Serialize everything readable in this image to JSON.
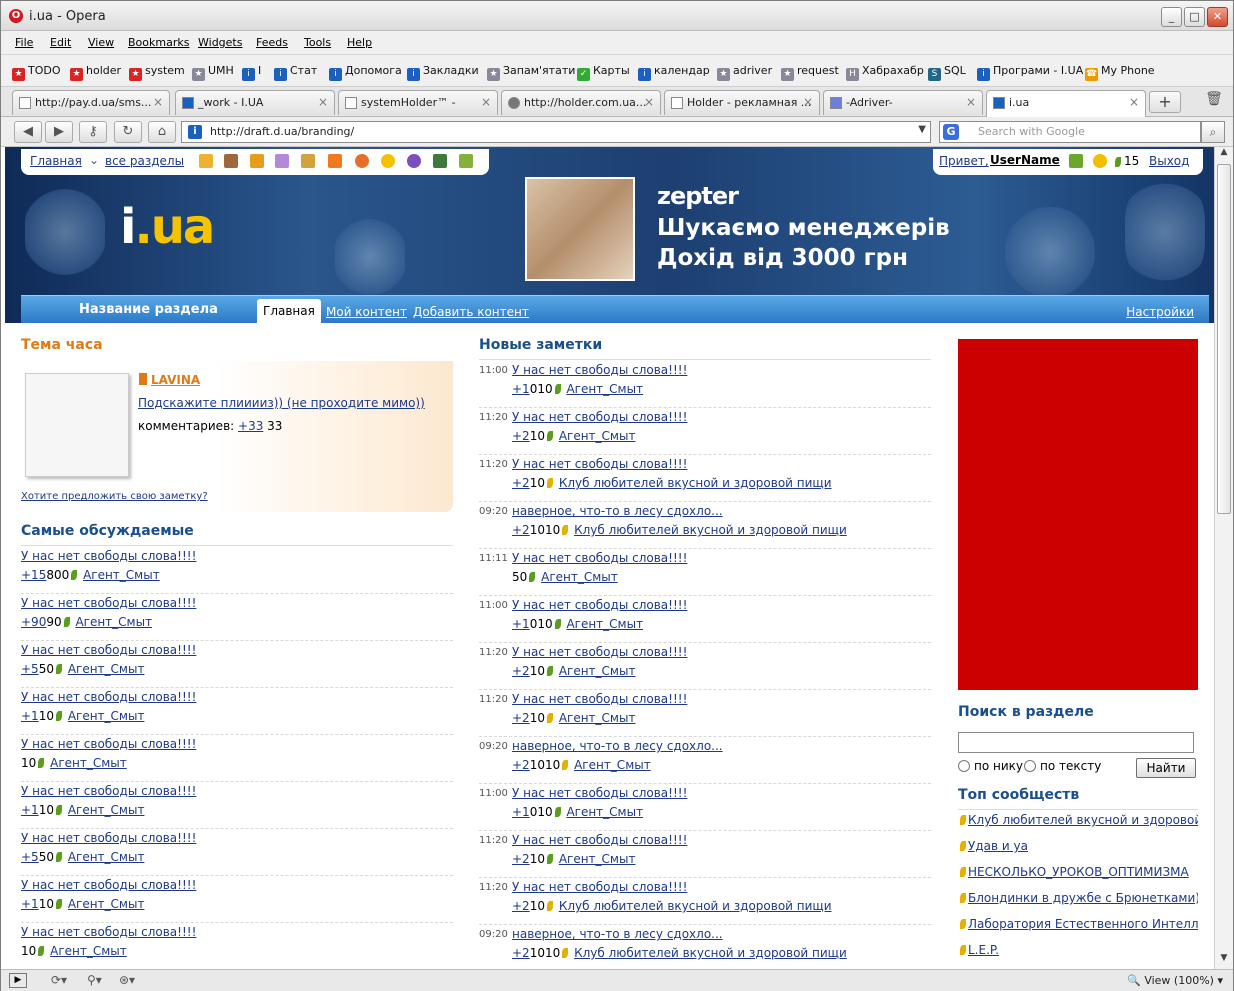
{
  "window": {
    "title": "i.ua - Opera",
    "opera_glyph": "O"
  },
  "menu": [
    "File",
    "Edit",
    "View",
    "Bookmarks",
    "Widgets",
    "Feeds",
    "Tools",
    "Help"
  ],
  "bookmarks": [
    {
      "label": "TODO",
      "color": "#d22"
    },
    {
      "label": "holder",
      "color": "#d22"
    },
    {
      "label": "system",
      "color": "#d22"
    },
    {
      "label": "UMH",
      "color": "#889"
    },
    {
      "label": "I",
      "color": "#1b5fbf"
    },
    {
      "label": "Стат",
      "color": "#1b5fbf"
    },
    {
      "label": "Допомога",
      "color": "#1b5fbf"
    },
    {
      "label": "Закладки",
      "color": "#1b5fbf"
    },
    {
      "label": "Запам'ятати",
      "color": "#889"
    },
    {
      "label": "Карты",
      "color": "#3a3"
    },
    {
      "label": "календар",
      "color": "#1b5fbf"
    },
    {
      "label": "adriver",
      "color": "#889"
    },
    {
      "label": "request",
      "color": "#889"
    },
    {
      "label": "Хабрахабр",
      "color": "#889"
    },
    {
      "label": "SQL",
      "color": "#268"
    },
    {
      "label": "Програми - I.UA",
      "color": "#1b5fbf"
    },
    {
      "label": "My Phone",
      "color": "#e90"
    }
  ],
  "tabs": [
    {
      "label": "http://pay.d.ua/sms...",
      "close": "×"
    },
    {
      "label": "_work - I.UA",
      "close": "×"
    },
    {
      "label": "systemHolder™ -",
      "close": "×"
    },
    {
      "label": "http://holder.com.ua...",
      "close": "×"
    },
    {
      "label": "Holder - рекламная ...",
      "close": "×"
    },
    {
      "label": "-Adriver-",
      "close": "×"
    },
    {
      "label": "i.ua",
      "close": "×"
    }
  ],
  "address": {
    "url": "http://draft.d.ua/branding/",
    "fav": "i",
    "dropdown": "▼",
    "search_placeholder": "Search with Google",
    "engine": "G"
  },
  "status": {
    "zoom": "View (100%)"
  },
  "topnav": {
    "home": "Главная",
    "all": "все разделы",
    "greeting": "Привет,",
    "user": "UserName",
    "count": "15",
    "logout": "Выход"
  },
  "logo": {
    "brand": "i",
    "tld": ".ua"
  },
  "ad": {
    "brand": "zepter",
    "line1": "Шукаємо менеджерів",
    "line2": "Дохід від 3000 грн"
  },
  "subnav": {
    "section": "Название раздела",
    "tabs": [
      "Главная",
      "Мой контент",
      "Добавить контент"
    ],
    "settings": "Настройки"
  },
  "topic": {
    "heading": "Тема часа",
    "author": "LAVINA",
    "title": "Подскажите плииииз)) (не проходите мимо))",
    "comments_label": "комментариев:",
    "comments_plus": "+33",
    "comments_num": "33",
    "suggest": "Хотите предложить свою заметку?"
  },
  "discussed": {
    "heading": "Самые обсуждаемые",
    "items": [
      {
        "title": "У нас нет свободы слова!!!!",
        "plus": "+15",
        "num": "800",
        "author": "Агент_Смыт"
      },
      {
        "title": "У нас нет свободы слова!!!!",
        "plus": "+90",
        "num": "90",
        "author": "Агент_Смыт"
      },
      {
        "title": "У нас нет свободы слова!!!!",
        "plus": "+5",
        "num": "50",
        "author": "Агент_Смыт"
      },
      {
        "title": "У нас нет свободы слова!!!!",
        "plus": "+1",
        "num": "10",
        "author": "Агент_Смыт"
      },
      {
        "title": "У нас нет свободы слова!!!!",
        "plus": "",
        "num": "10",
        "author": "Агент_Смыт"
      },
      {
        "title": "У нас нет свободы слова!!!!",
        "plus": "+1",
        "num": "10",
        "author": "Агент_Смыт"
      },
      {
        "title": "У нас нет свободы слова!!!!",
        "plus": "+5",
        "num": "50",
        "author": "Агент_Смыт"
      },
      {
        "title": "У нас нет свободы слова!!!!",
        "plus": "+1",
        "num": "10",
        "author": "Агент_Смыт"
      },
      {
        "title": "У нас нет свободы слова!!!!",
        "plus": "",
        "num": "10",
        "author": "Агент_Смыт"
      }
    ]
  },
  "notes": {
    "heading": "Новые заметки",
    "items": [
      {
        "time": "11:00",
        "title": "У нас нет свободы слова!!!!",
        "plus": "+1",
        "num": "010",
        "club": false,
        "author": "Агент_Смыт"
      },
      {
        "time": "11:20",
        "title": "У нас нет свободы слова!!!!",
        "plus": "+2",
        "num": "10",
        "club": false,
        "author": "Агент_Смыт"
      },
      {
        "time": "11:20",
        "title": "У нас нет свободы слова!!!!",
        "plus": "+2",
        "num": "10",
        "club": true,
        "author": "Клуб любителей вкусной и здоровой пищи"
      },
      {
        "time": "09:20",
        "title": "наверное, что-то в лесу сдохло...",
        "plus": "+2",
        "num": "1010",
        "club": true,
        "author": "Клуб любителей вкусной и здоровой пищи"
      },
      {
        "time": "11:11",
        "title": "У нас нет свободы слова!!!!",
        "plus": "",
        "num": "50",
        "club": false,
        "author": "Агент_Смыт"
      },
      {
        "time": "11:00",
        "title": "У нас нет свободы слова!!!!",
        "plus": "+1",
        "num": "010",
        "club": false,
        "author": "Агент_Смыт"
      },
      {
        "time": "11:20",
        "title": "У нас нет свободы слова!!!!",
        "plus": "+2",
        "num": "10",
        "club": false,
        "author": "Агент_Смыт"
      },
      {
        "time": "11:20",
        "title": "У нас нет свободы слова!!!!",
        "plus": "+2",
        "num": "10",
        "club": true,
        "author": "Агент_Смыт"
      },
      {
        "time": "09:20",
        "title": "наверное, что-то в лесу сдохло...",
        "plus": "+2",
        "num": "1010",
        "club": true,
        "author": "Агент_Смыт"
      },
      {
        "time": "11:00",
        "title": "У нас нет свободы слова!!!!",
        "plus": "+1",
        "num": "010",
        "club": false,
        "author": "Агент_Смыт"
      },
      {
        "time": "11:20",
        "title": "У нас нет свободы слова!!!!",
        "plus": "+2",
        "num": "10",
        "club": false,
        "author": "Агент_Смыт"
      },
      {
        "time": "11:20",
        "title": "У нас нет свободы слова!!!!",
        "plus": "+2",
        "num": "10",
        "club": true,
        "author": "Клуб любителей вкусной и здоровой пищи"
      },
      {
        "time": "09:20",
        "title": "наверное, что-то в лесу сдохло...",
        "plus": "+2",
        "num": "1010",
        "club": true,
        "author": "Клуб любителей вкусной и здоровой пищи"
      }
    ]
  },
  "section_search": {
    "heading": "Поиск в разделе",
    "opt_nick": "по нику",
    "opt_text": "по тексту",
    "button": "Найти"
  },
  "top_communities": {
    "heading": "Топ сообществ",
    "items": [
      "Клуб любителей вкусной и здоровой",
      "Удав и уа",
      "НЕСКОЛЬКО_УРОКОВ_ОПТИМИЗМА",
      "Блондинки в дружбе с Брюнетками)))",
      "Лаборатория Естественного Интеллек",
      "L.E.P."
    ]
  }
}
